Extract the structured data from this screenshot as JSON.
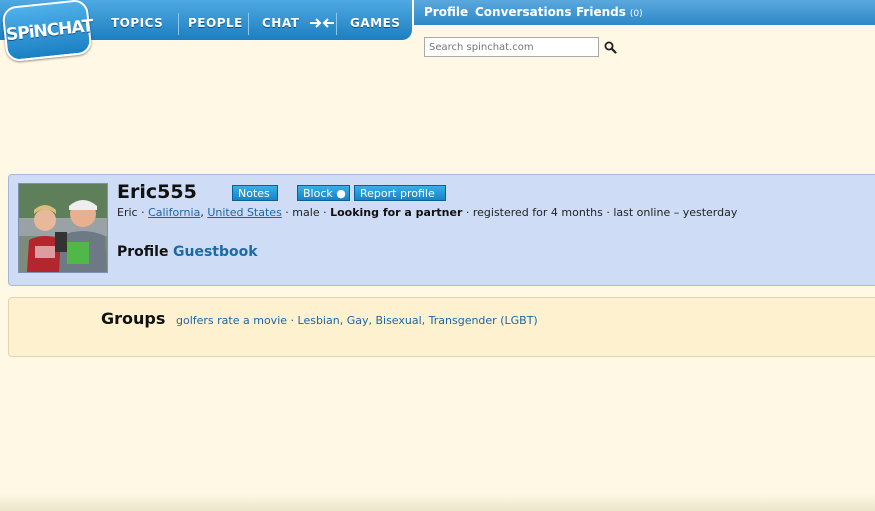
{
  "logo": {
    "text": "SPiNCHAT"
  },
  "nav": {
    "topics": "TOPICS",
    "people": "PEOPLE",
    "chat": "CHAT",
    "games": "GAMES"
  },
  "userbar": {
    "profile": "Profile",
    "conversations": "Conversations",
    "friends": "Friends",
    "friends_count": "(0)"
  },
  "search": {
    "placeholder": "Search spinchat.com",
    "icon": "search-icon"
  },
  "profile": {
    "username": "Eric555",
    "buttons": {
      "notes": "Notes",
      "block": "Block ●",
      "report": "Report profile"
    },
    "info": {
      "name": "Eric",
      "sep1": " · ",
      "state": "California",
      "comma": ", ",
      "country": "United States",
      "gender": " · male · ",
      "looking": "Looking for a partner",
      "registered": " · registered for 4 months · last online – yesterday"
    },
    "tabs": {
      "profile": "Profile",
      "guestbook": "Guestbook"
    }
  },
  "groups": {
    "title": "Groups",
    "items": [
      "golfers rate a movie",
      "Lesbian, Gay, Bisexual, Transgender (LGBT)"
    ],
    "sep": " · "
  },
  "colors": {
    "nav_blue": "#1d7fc0",
    "link_blue": "#1a66a6",
    "profile_bg": "#cfdcf5",
    "groups_bg": "#fdf1cf",
    "page_bg": "#fff8e5"
  }
}
